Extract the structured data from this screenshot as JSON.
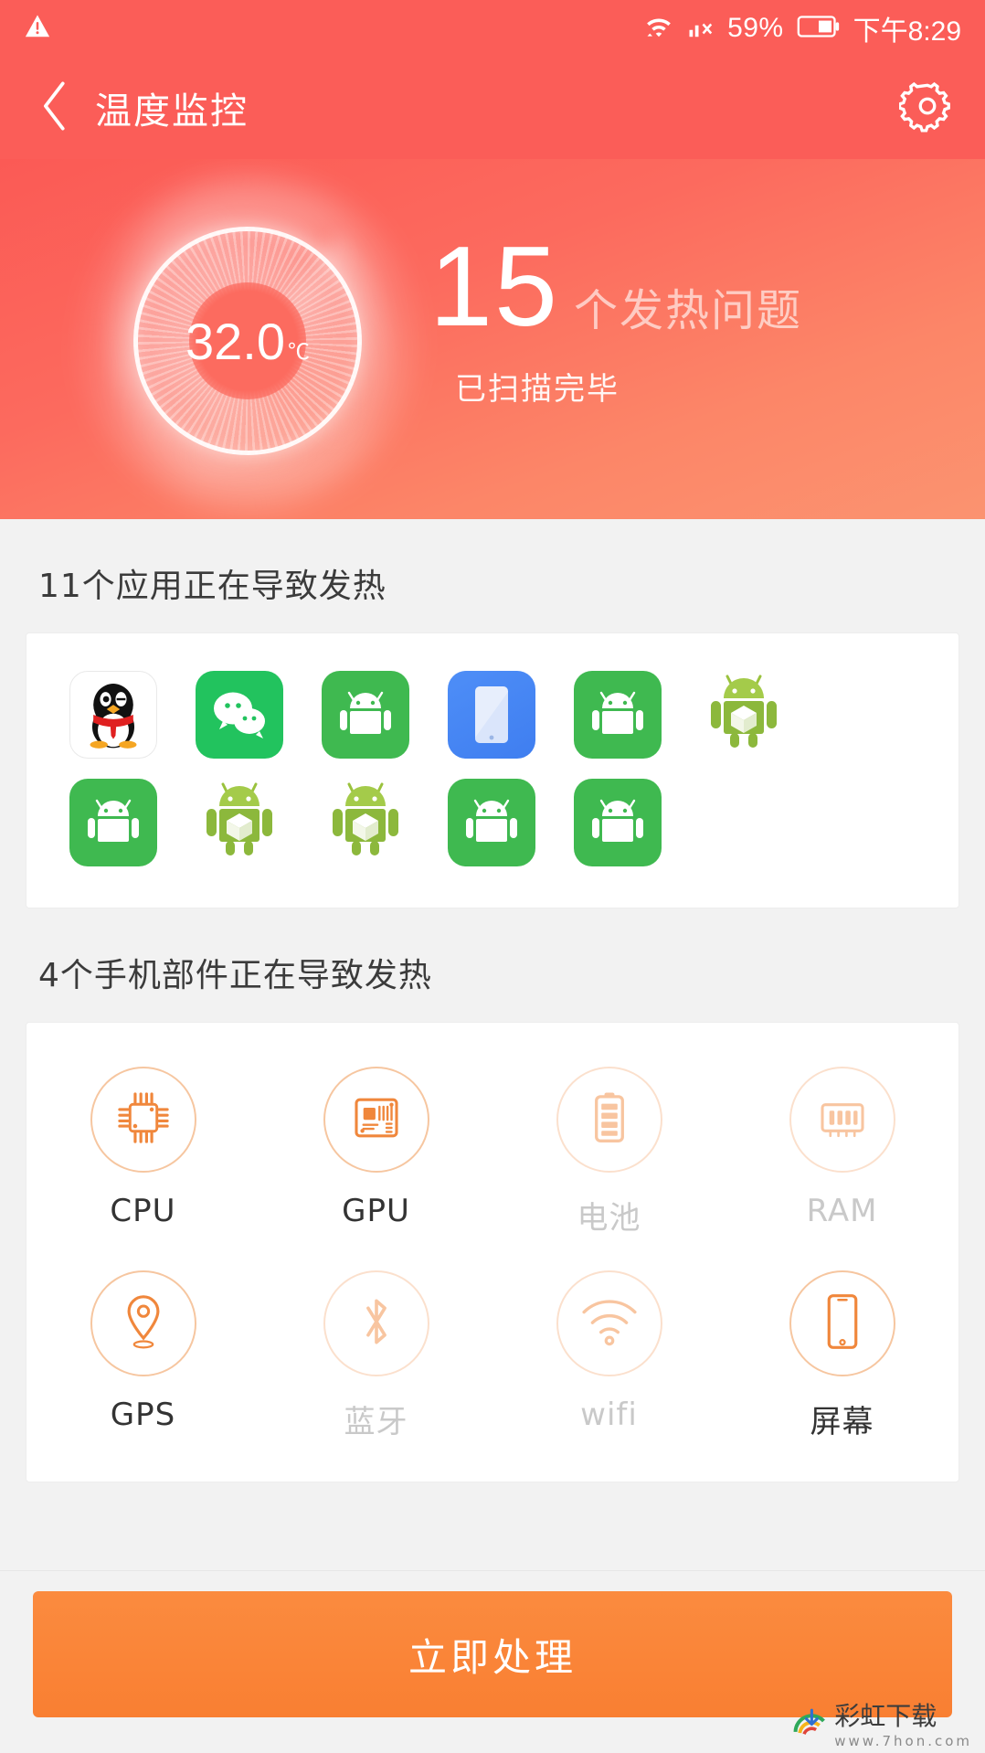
{
  "status_bar": {
    "warning_icon": "warning-triangle-icon",
    "wifi_icon": "wifi-icon",
    "signal_icon": "signal-no-service-icon",
    "battery_percent": "59%",
    "battery_icon": "battery-icon",
    "time": "下午8:29"
  },
  "app_bar": {
    "back_icon": "back-chevron-icon",
    "title": "温度监控",
    "settings_icon": "gear-icon"
  },
  "hero": {
    "temperature": "32.0",
    "temperature_unit": "℃",
    "issue_count": "15",
    "issue_label": "个发热问题",
    "scan_status": "已扫描完毕"
  },
  "apps_section": {
    "title": "11个应用正在导致发热",
    "rows": [
      [
        {
          "name": "qq-app-icon",
          "style": "qq"
        },
        {
          "name": "wechat-app-icon",
          "style": "wechat"
        },
        {
          "name": "android-app-icon",
          "style": "green"
        },
        {
          "name": "phone-manager-app-icon",
          "style": "blue"
        },
        {
          "name": "android-app-icon",
          "style": "green"
        },
        {
          "name": "apk-installer-icon",
          "style": "robot3d"
        }
      ],
      [
        {
          "name": "android-app-icon",
          "style": "green"
        },
        {
          "name": "apk-installer-icon",
          "style": "robot3d"
        },
        {
          "name": "apk-installer-icon",
          "style": "robot3d"
        },
        {
          "name": "android-app-icon",
          "style": "green"
        },
        {
          "name": "android-app-icon",
          "style": "green"
        }
      ]
    ]
  },
  "components_section": {
    "title": "4个手机部件正在导致发热",
    "rows": [
      [
        {
          "label": "CPU",
          "icon": "cpu-icon",
          "active": true
        },
        {
          "label": "GPU",
          "icon": "gpu-icon",
          "active": true
        },
        {
          "label": "电池",
          "icon": "battery-icon",
          "active": false
        },
        {
          "label": "RAM",
          "icon": "ram-icon",
          "active": false
        }
      ],
      [
        {
          "label": "GPS",
          "icon": "location-pin-icon",
          "active": true
        },
        {
          "label": "蓝牙",
          "icon": "bluetooth-icon",
          "active": false
        },
        {
          "label": "wifi",
          "icon": "wifi-icon",
          "active": false
        },
        {
          "label": "屏幕",
          "icon": "screen-icon",
          "active": true
        }
      ]
    ]
  },
  "bottom": {
    "cta_label": "立即处理",
    "watermark_text": "彩虹下载",
    "watermark_sub": "www.7hon.com",
    "watermark_icon": "rainbow-logo-icon"
  },
  "colors": {
    "header_red": "#fb5d58",
    "hero_gradient_end": "#fb9370",
    "cta_orange": "#f97f32",
    "accent_orange": "#f0873c",
    "inactive_gray": "#c9c9c9"
  }
}
